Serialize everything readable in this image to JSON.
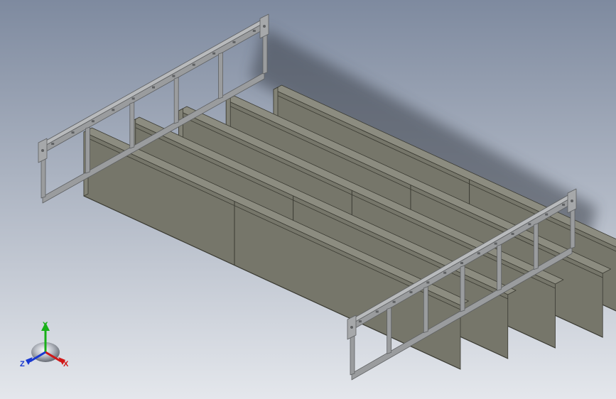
{
  "viewport": {
    "background_top": "#7e8a9f",
    "background_bottom": "#e4e7ec",
    "model": {
      "name": "cable-tray-frame-assembly",
      "panel_count": 5,
      "rung_count_near": 6,
      "colors": {
        "panel_face": "#76766a",
        "panel_face_light": "#828276",
        "panel_top": "#8c8c80",
        "panel_edge": "#3b3b33",
        "steel": "#9a9c9e",
        "steel_dark": "#5e6062",
        "shadow": "#3a3f4a"
      }
    },
    "triad": {
      "x_label": "X",
      "y_label": "Y",
      "z_label": "Z",
      "x_color": "#d01818",
      "y_color": "#18b018",
      "z_color": "#1838d0"
    }
  }
}
